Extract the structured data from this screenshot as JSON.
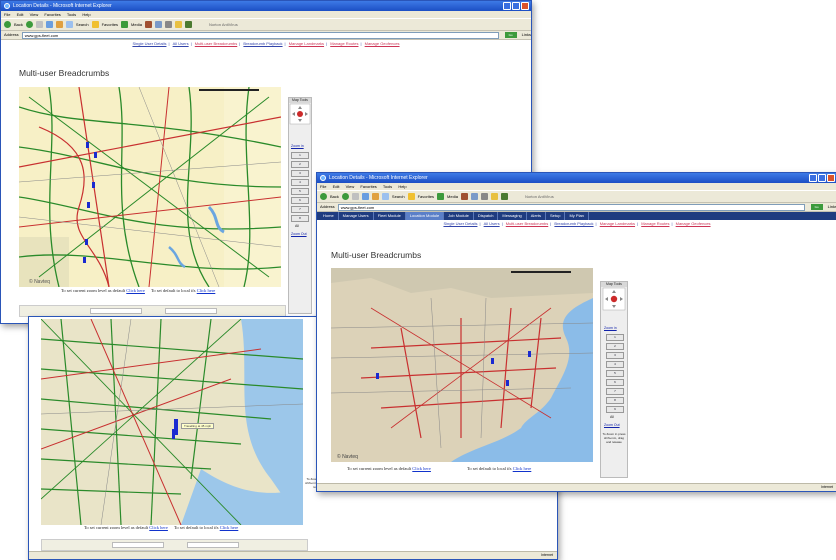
{
  "browser": {
    "title": "Location Details - Microsoft Internet Explorer",
    "menus": [
      "File",
      "Edit",
      "View",
      "Favorites",
      "Tools",
      "Help"
    ],
    "toolbar": {
      "back": "Back",
      "search": "Search",
      "favorites": "Favorites",
      "media": "Media",
      "norton": "Norton AntiVirus"
    },
    "address_label": "Address",
    "address": "www.gps-fleet.com",
    "go": "Go",
    "links": "Links",
    "status_zone": "Internet"
  },
  "nav": {
    "tabs": [
      "Home",
      "Manage Users",
      "Fleet Module",
      "Location Module",
      "Job Module",
      "Dispatch",
      "Messaging",
      "Alerts",
      "Setup",
      "My Plan"
    ],
    "active_tab": 3
  },
  "sublinks": [
    "Single User Details",
    "All Users",
    "Multi-user Breadcrumbs",
    "Breadcrumb Playback",
    "Manage Landmarks",
    "Manage Routes",
    "Manage Geofences"
  ],
  "page": {
    "title": "Multi-user Breadcrumbs",
    "zoom_note": "To set current zoom level as default",
    "map_note": "To set default to local ifs",
    "click_here": "Click here",
    "help_text": "To Zoom in press shift+mm, drag and release"
  },
  "map_view": {
    "header": "Map Tools",
    "zoom_select_label": "Zoom in",
    "zoom_levels": [
      "1",
      "2",
      "3",
      "4",
      "5",
      "6",
      "7",
      "8",
      "9",
      "10"
    ],
    "zoom_all": "All",
    "zoom_reset": "Zoom Out"
  },
  "map_tooltip": "Travelling at 45 mph",
  "map_credit": "© Navteq",
  "legend_scale": "200 mi"
}
